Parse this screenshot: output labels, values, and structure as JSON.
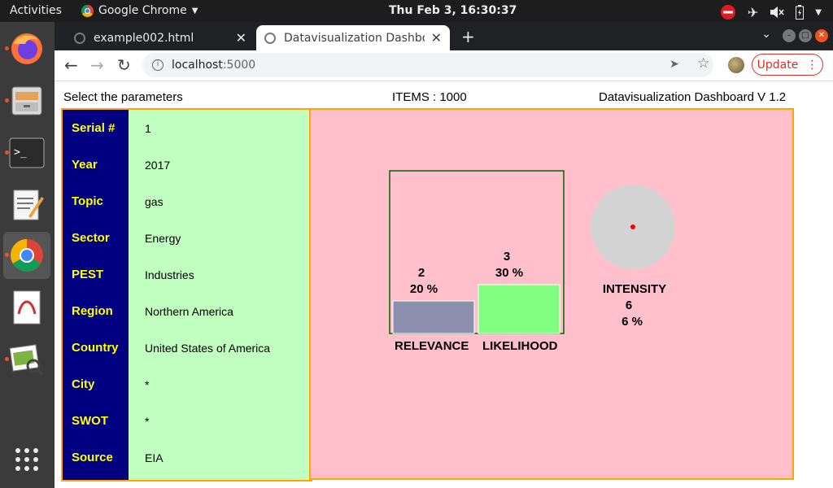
{
  "system": {
    "activities": "Activities",
    "app_name": "Google Chrome",
    "clock": "Thu Feb  3, 16:30:37"
  },
  "browser": {
    "tabs": [
      {
        "title": "example002.html"
      },
      {
        "title": "Datavisualization Dashbo"
      }
    ],
    "url_host": "localhost",
    "url_port": ":5000",
    "update_label": "Update"
  },
  "page": {
    "select_label": "Select the parameters",
    "items_label": "ITEMS : 1000",
    "version_label": "Datavisualization Dashboard V 1.2",
    "parameters": [
      {
        "key": "Serial #",
        "value": "1"
      },
      {
        "key": "Year",
        "value": "2017"
      },
      {
        "key": "Topic",
        "value": "gas"
      },
      {
        "key": "Sector",
        "value": "Energy"
      },
      {
        "key": "PEST",
        "value": "Industries"
      },
      {
        "key": "Region",
        "value": "Northern America"
      },
      {
        "key": "Country",
        "value": "United States of America"
      },
      {
        "key": "City",
        "value": "*"
      },
      {
        "key": "SWOT",
        "value": "*"
      },
      {
        "key": "Source",
        "value": "EIA"
      }
    ]
  },
  "chart_data": {
    "type": "bar",
    "categories": [
      "RELEVANCE",
      "LIKELIHOOD"
    ],
    "values": [
      2,
      3
    ],
    "value_labels": [
      "2",
      "3"
    ],
    "percent_labels": [
      "20 %",
      "30 %"
    ],
    "percent_values": [
      20,
      30
    ],
    "ylim": [
      0,
      10
    ],
    "bar_colors": [
      "#8c8fae",
      "#80ff80"
    ],
    "frame_color": "#006400",
    "intensity": {
      "label": "INTENSITY",
      "value_label": "6",
      "percent_label": "6 %",
      "circle_color": "#d3d3d3",
      "dot_color": "#ff0000"
    }
  }
}
